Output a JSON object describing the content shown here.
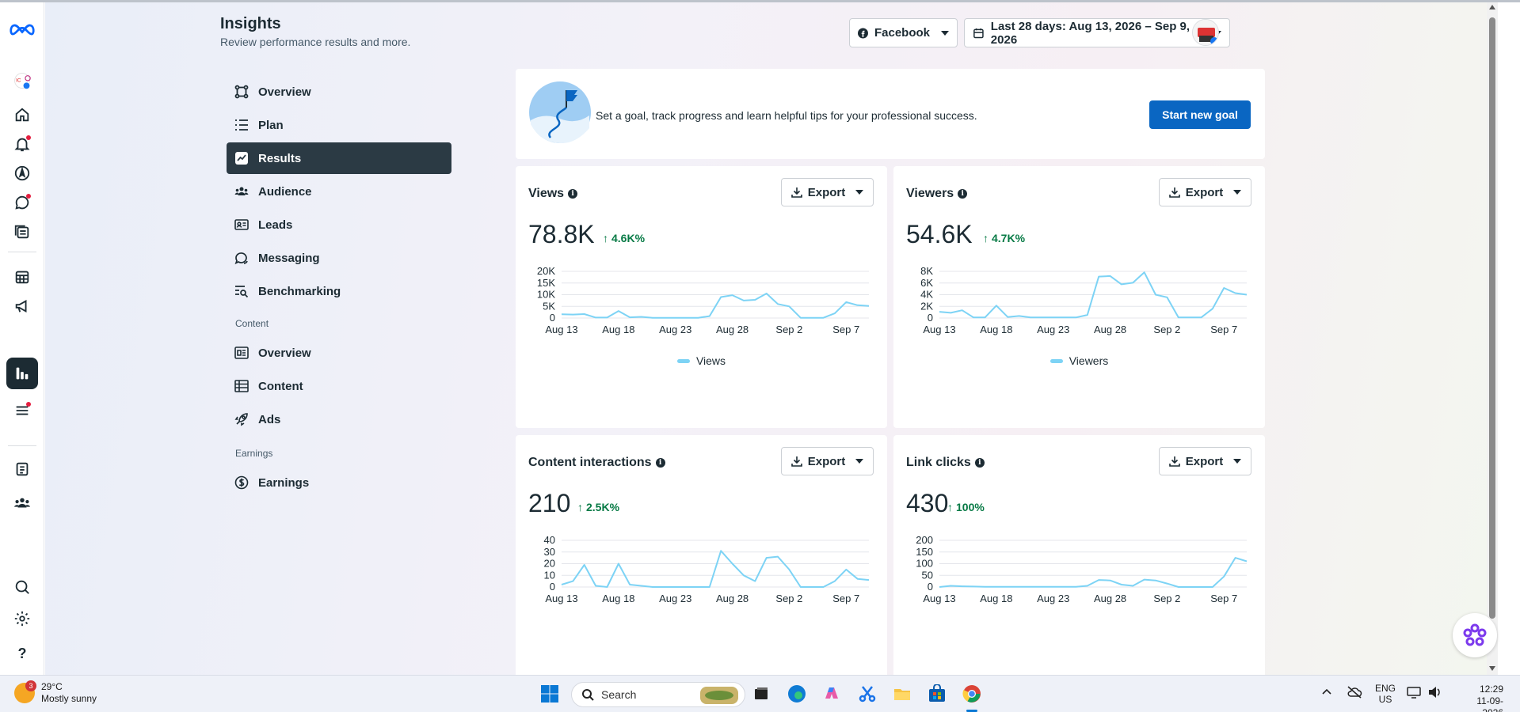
{
  "header": {
    "title": "Insights",
    "subtitle": "Review performance results and more.",
    "platform_selector": "Facebook",
    "date_range": "Last 28 days: Aug 13, 2026 – Sep 9, 2026"
  },
  "nav": {
    "items": [
      {
        "label": "Overview",
        "icon": "overview-icon"
      },
      {
        "label": "Plan",
        "icon": "plan-list-icon"
      },
      {
        "label": "Results",
        "icon": "results-chart-icon",
        "active": true
      },
      {
        "label": "Audience",
        "icon": "audience-icon"
      },
      {
        "label": "Leads",
        "icon": "leads-card-icon"
      },
      {
        "label": "Messaging",
        "icon": "messaging-bubble-icon"
      },
      {
        "label": "Benchmarking",
        "icon": "benchmarking-icon"
      }
    ],
    "content_section": "Content",
    "content_items": [
      {
        "label": "Overview",
        "icon": "content-overview-icon"
      },
      {
        "label": "Content",
        "icon": "content-table-icon"
      },
      {
        "label": "Ads",
        "icon": "ads-rocket-icon"
      }
    ],
    "earnings_section": "Earnings",
    "earnings_items": [
      {
        "label": "Earnings",
        "icon": "dollar-circle-icon"
      }
    ]
  },
  "goal_banner": {
    "text": "Set a goal, track progress and learn helpful tips for your professional success.",
    "button": "Start new goal"
  },
  "export_label": "Export",
  "x_tick_labels": [
    "Aug 13",
    "Aug 18",
    "Aug 23",
    "Aug 28",
    "Sep 2",
    "Sep 7"
  ],
  "line_color": "#7dd3f5",
  "metrics": {
    "views": {
      "title": "Views",
      "value": "78.8K",
      "delta": "4.6K%",
      "legend": "Views"
    },
    "viewers": {
      "title": "Viewers",
      "value": "54.6K",
      "delta": "4.7K%",
      "legend": "Viewers"
    },
    "interactions": {
      "title": "Content interactions",
      "value": "210",
      "delta": "2.5K%"
    },
    "link_clicks": {
      "title": "Link clicks",
      "value": "430",
      "delta": "100%"
    }
  },
  "chart_data": [
    {
      "type": "line",
      "title": "Views",
      "x": [
        "Aug 13",
        "Aug 14",
        "Aug 15",
        "Aug 16",
        "Aug 17",
        "Aug 18",
        "Aug 19",
        "Aug 20",
        "Aug 21",
        "Aug 22",
        "Aug 23",
        "Aug 24",
        "Aug 25",
        "Aug 26",
        "Aug 27",
        "Aug 28",
        "Aug 29",
        "Aug 30",
        "Aug 31",
        "Sep 1",
        "Sep 2",
        "Sep 3",
        "Sep 4",
        "Sep 5",
        "Sep 6",
        "Sep 7",
        "Sep 8",
        "Sep 9"
      ],
      "series": [
        {
          "name": "Views",
          "values": [
            1600,
            1500,
            1700,
            200,
            200,
            3000,
            300,
            500,
            100,
            100,
            100,
            100,
            100,
            800,
            9000,
            9800,
            7500,
            7800,
            10500,
            6000,
            5000,
            100,
            100,
            100,
            2000,
            6800,
            5500,
            5200
          ]
        }
      ],
      "yticks": [
        "0",
        "5K",
        "10K",
        "15K",
        "20K"
      ],
      "ylim": [
        0,
        20000
      ]
    },
    {
      "type": "line",
      "title": "Viewers",
      "x": [
        "Aug 13",
        "Aug 14",
        "Aug 15",
        "Aug 16",
        "Aug 17",
        "Aug 18",
        "Aug 19",
        "Aug 20",
        "Aug 21",
        "Aug 22",
        "Aug 23",
        "Aug 24",
        "Aug 25",
        "Aug 26",
        "Aug 27",
        "Aug 28",
        "Aug 29",
        "Aug 30",
        "Aug 31",
        "Sep 1",
        "Sep 2",
        "Sep 3",
        "Sep 4",
        "Sep 5",
        "Sep 6",
        "Sep 7",
        "Sep 8",
        "Sep 9"
      ],
      "series": [
        {
          "name": "Viewers",
          "values": [
            1200,
            1000,
            1500,
            100,
            100,
            2400,
            200,
            400,
            100,
            100,
            100,
            100,
            100,
            600,
            8000,
            8100,
            6500,
            6800,
            8800,
            4500,
            4000,
            100,
            100,
            100,
            1800,
            5800,
            4800,
            4500
          ]
        }
      ],
      "yticks": [
        "0",
        "2K",
        "4K",
        "6K",
        "8K"
      ],
      "ylim": [
        0,
        9000
      ]
    },
    {
      "type": "line",
      "title": "Content interactions",
      "x": [
        "Aug 13",
        "Aug 14",
        "Aug 15",
        "Aug 16",
        "Aug 17",
        "Aug 18",
        "Aug 19",
        "Aug 20",
        "Aug 21",
        "Aug 22",
        "Aug 23",
        "Aug 24",
        "Aug 25",
        "Aug 26",
        "Aug 27",
        "Aug 28",
        "Aug 29",
        "Aug 30",
        "Aug 31",
        "Sep 1",
        "Sep 2",
        "Sep 3",
        "Sep 4",
        "Sep 5",
        "Sep 6",
        "Sep 7",
        "Sep 8",
        "Sep 9"
      ],
      "series": [
        {
          "name": "Content interactions",
          "values": [
            2,
            5,
            19,
            1,
            0,
            20,
            2,
            1,
            0,
            0,
            0,
            0,
            0,
            0,
            31,
            20,
            10,
            5,
            25,
            26,
            15,
            0,
            0,
            0,
            5,
            15,
            7,
            6
          ]
        }
      ],
      "yticks": [
        "0",
        "10",
        "20",
        "30",
        "40"
      ],
      "ylim": [
        0,
        40
      ]
    },
    {
      "type": "line",
      "title": "Link clicks",
      "x": [
        "Aug 13",
        "Aug 14",
        "Aug 15",
        "Aug 16",
        "Aug 17",
        "Aug 18",
        "Aug 19",
        "Aug 20",
        "Aug 21",
        "Aug 22",
        "Aug 23",
        "Aug 24",
        "Aug 25",
        "Aug 26",
        "Aug 27",
        "Aug 28",
        "Aug 29",
        "Aug 30",
        "Aug 31",
        "Sep 1",
        "Sep 2",
        "Sep 3",
        "Sep 4",
        "Sep 5",
        "Sep 6",
        "Sep 7",
        "Sep 8",
        "Sep 9"
      ],
      "series": [
        {
          "name": "Link clicks",
          "values": [
            0,
            5,
            3,
            2,
            1,
            1,
            1,
            1,
            1,
            1,
            1,
            1,
            1,
            5,
            30,
            28,
            10,
            5,
            32,
            28,
            15,
            0,
            0,
            0,
            0,
            45,
            125,
            110
          ]
        }
      ],
      "yticks": [
        "0",
        "50",
        "100",
        "150",
        "200"
      ],
      "ylim": [
        0,
        200
      ]
    }
  ],
  "taskbar": {
    "temperature": "29°C",
    "weather": "Mostly sunny",
    "weather_badge": "3",
    "search_placeholder": "Search",
    "language": "ENG",
    "region": "US",
    "time": "12:29",
    "date": "11-09-2026"
  }
}
